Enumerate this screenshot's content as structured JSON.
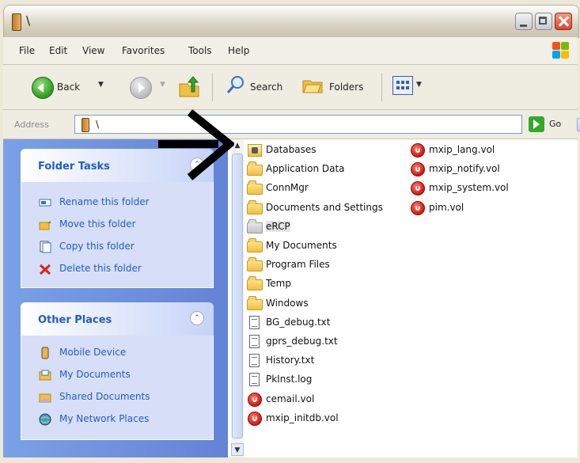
{
  "window": {
    "title": "\\"
  },
  "menu": [
    "File",
    "Edit",
    "View",
    "Favorites",
    "Tools",
    "Help"
  ],
  "toolbar": {
    "back": "Back",
    "search": "Search",
    "folders": "Folders"
  },
  "address": {
    "label": "Address",
    "value": "\\",
    "go": "Go"
  },
  "folder_tasks": {
    "title": "Folder Tasks",
    "items": [
      "Rename this folder",
      "Move this folder",
      "Copy this folder",
      "Delete this folder"
    ]
  },
  "other_places": {
    "title": "Other Places",
    "items": [
      "Mobile Device",
      "My Documents",
      "Shared Documents",
      "My Network Places"
    ]
  },
  "files": {
    "col1": [
      {
        "name": "Databases",
        "type": "database"
      },
      {
        "name": "Application Data",
        "type": "folder"
      },
      {
        "name": "ConnMgr",
        "type": "folder"
      },
      {
        "name": "Documents and Settings",
        "type": "folder"
      },
      {
        "name": "eRCP",
        "type": "folder-selected"
      },
      {
        "name": "My Documents",
        "type": "folder"
      },
      {
        "name": "Program Files",
        "type": "folder"
      },
      {
        "name": "Temp",
        "type": "folder"
      },
      {
        "name": "Windows",
        "type": "folder"
      },
      {
        "name": "BG_debug.txt",
        "type": "text"
      },
      {
        "name": "gprs_debug.txt",
        "type": "text"
      },
      {
        "name": "History.txt",
        "type": "text"
      },
      {
        "name": "PkInst.log",
        "type": "text"
      },
      {
        "name": "cemail.vol",
        "type": "vol"
      },
      {
        "name": "mxip_initdb.vol",
        "type": "vol"
      }
    ],
    "col2": [
      {
        "name": "mxip_lang.vol",
        "type": "vol"
      },
      {
        "name": "mxip_notify.vol",
        "type": "vol"
      },
      {
        "name": "mxip_system.vol",
        "type": "vol"
      },
      {
        "name": "pim.vol",
        "type": "vol"
      }
    ]
  },
  "colors": {
    "task_pane_bg": "#6f92df",
    "pane_title": "#215dc6",
    "selection": "#e4e4e4"
  }
}
